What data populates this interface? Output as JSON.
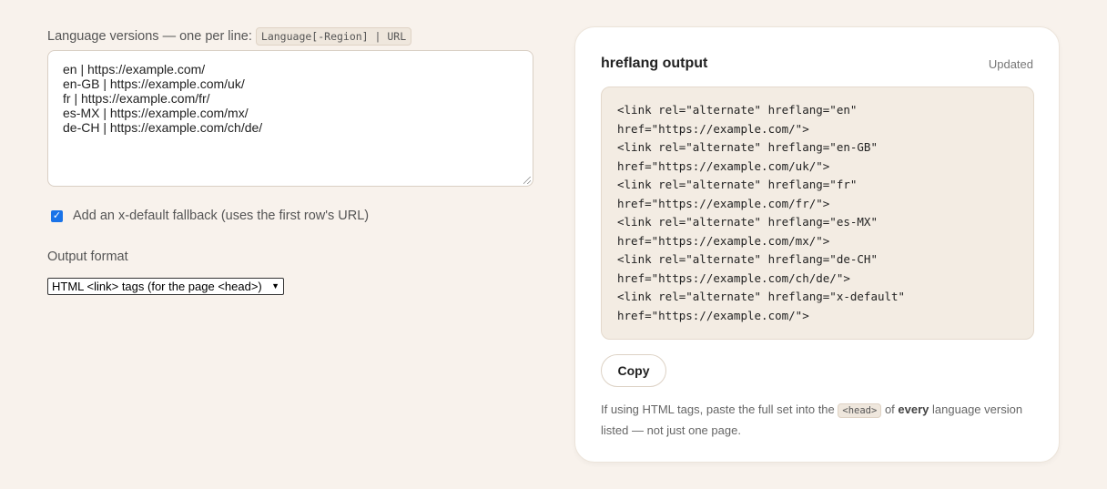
{
  "input": {
    "label": "Language versions — one per line:",
    "format_hint": "Language[-Region] | URL",
    "value": "en | https://example.com/\nen-GB | https://example.com/uk/\nfr | https://example.com/fr/\nes-MX | https://example.com/mx/\nde-CH | https://example.com/ch/de/"
  },
  "xdefault": {
    "checked": true,
    "label": "Add an x-default fallback (uses the first row's URL)"
  },
  "format": {
    "label": "Output format",
    "selected": "HTML <link> tags (for the page <head>)"
  },
  "output": {
    "title": "hreflang output",
    "status": "Updated",
    "code": "<link rel=\"alternate\" hreflang=\"en\"\nhref=\"https://example.com/\">\n<link rel=\"alternate\" hreflang=\"en-GB\"\nhref=\"https://example.com/uk/\">\n<link rel=\"alternate\" hreflang=\"fr\"\nhref=\"https://example.com/fr/\">\n<link rel=\"alternate\" hreflang=\"es-MX\"\nhref=\"https://example.com/mx/\">\n<link rel=\"alternate\" hreflang=\"de-CH\"\nhref=\"https://example.com/ch/de/\">\n<link rel=\"alternate\" hreflang=\"x-default\"\nhref=\"https://example.com/\">",
    "copy_label": "Copy",
    "note_pre": "If using HTML tags, paste the full set into the",
    "note_chip": "<head>",
    "note_mid": "of",
    "note_bold": "every",
    "note_post": "language version listed — not just one page."
  }
}
